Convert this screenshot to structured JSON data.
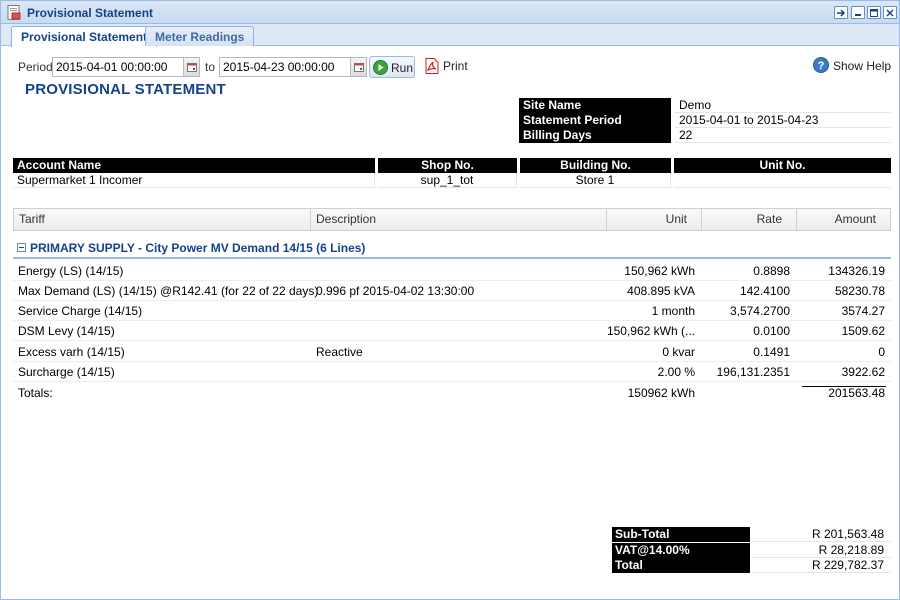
{
  "window": {
    "title": "Provisional Statement",
    "controls": [
      "pin-icon",
      "minimize-icon",
      "maximize-icon",
      "close-icon"
    ]
  },
  "tabs": [
    {
      "label": "Provisional Statement",
      "active": true
    },
    {
      "label": "Meter Readings",
      "active": false
    }
  ],
  "toolbar": {
    "period_label": "Period",
    "from_value": "2015-04-01 00:00:00",
    "to_label": "to",
    "to_value": "2015-04-23 00:00:00",
    "run_label": "Run",
    "print_label": "Print",
    "help_label": "Show Help"
  },
  "statement": {
    "title": "PROVISIONAL STATEMENT",
    "info": [
      {
        "key": "Site Name",
        "value": "Demo"
      },
      {
        "key": "Statement Period",
        "value": "2015-04-01 to 2015-04-23"
      },
      {
        "key": "Billing Days",
        "value": "22"
      }
    ],
    "account_headers": {
      "account_name": "Account Name",
      "shop_no": "Shop No.",
      "building_no": "Building No.",
      "unit_no": "Unit No."
    },
    "account": {
      "account_name": "Supermarket 1 Incomer",
      "shop_no": "sup_1_tot",
      "building_no": "Store 1",
      "unit_no": ""
    }
  },
  "grid": {
    "columns": {
      "tariff": "Tariff",
      "description": "Description",
      "unit": "Unit",
      "rate": "Rate",
      "amount": "Amount"
    },
    "group_label": "PRIMARY SUPPLY - City Power MV Demand 14/15 (6 Lines)",
    "rows": [
      {
        "tariff": "Energy (LS) (14/15)",
        "description": "",
        "unit": "150,962 kWh",
        "rate": "0.8898",
        "amount": "134326.19"
      },
      {
        "tariff": "Max Demand (LS) (14/15) @R142.41 (for 22 of 22 days)",
        "description": "0.996 pf 2015-04-02 13:30:00",
        "unit": "408.895 kVA",
        "rate": "142.4100",
        "amount": "58230.78"
      },
      {
        "tariff": "Service Charge (14/15)",
        "description": "",
        "unit": "1 month",
        "rate": "3,574.2700",
        "amount": "3574.27"
      },
      {
        "tariff": "DSM Levy (14/15)",
        "description": "",
        "unit": "150,962 kWh (...",
        "rate": "0.0100",
        "amount": "1509.62"
      },
      {
        "tariff": "Excess varh (14/15)",
        "description": "Reactive",
        "unit": "0 kvar",
        "rate": "0.1491",
        "amount": "0"
      },
      {
        "tariff": "Surcharge (14/15)",
        "description": "",
        "unit": "2.00 %",
        "rate": "196,131.2351",
        "amount": "3922.62"
      }
    ],
    "totals": {
      "label": "Totals:",
      "unit": "150962 kWh",
      "amount": "201563.48"
    }
  },
  "summary": [
    {
      "key": "Sub-Total",
      "value": "R 201,563.48"
    },
    {
      "key": "VAT@14.00%",
      "value": "R 28,218.89"
    },
    {
      "key": "Total",
      "value": "R 229,782.37"
    }
  ]
}
